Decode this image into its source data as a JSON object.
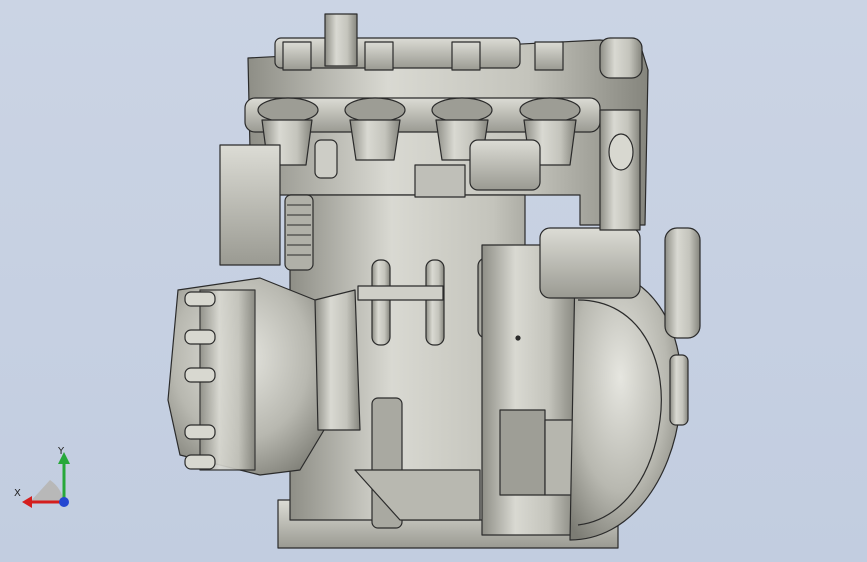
{
  "triad": {
    "x_label": "X",
    "y_label": "Y",
    "x_color": "#d41e1e",
    "y_color": "#27a83a",
    "z_color": "#2447d1"
  },
  "scene": {
    "background": "#c2cde0",
    "model_fill": "#c6c6bf",
    "model_edge": "#2b2b2b",
    "icon": "engine-model-icon"
  }
}
